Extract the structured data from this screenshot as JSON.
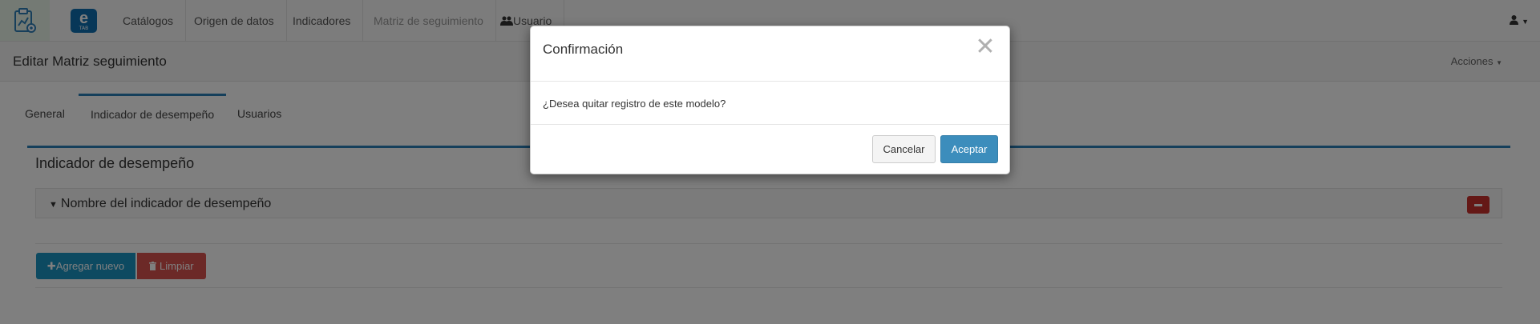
{
  "navbar": {
    "logo_icon": "clipboard-chart-icon",
    "brand_letter": "e",
    "brand_sub": "TAB",
    "items": [
      {
        "label": "Catálogos"
      },
      {
        "label": "Origen de datos"
      },
      {
        "label": "Indicadores"
      },
      {
        "label": "Matriz de seguimiento"
      },
      {
        "label": "Usuario"
      }
    ],
    "user_icon": "user-icon"
  },
  "page": {
    "title": "Editar Matriz seguimiento",
    "actions_label": "Acciones"
  },
  "tabs": [
    {
      "label": "General"
    },
    {
      "label": "Indicador de desempeño"
    },
    {
      "label": "Usuarios"
    }
  ],
  "panel": {
    "title": "Indicador de desempeño",
    "accordion_label": "Nombre del indicador de desempeño",
    "add_button": "Agregar nuevo",
    "clear_button": "Limpiar"
  },
  "modal": {
    "title": "Confirmación",
    "close_glyph": "✕",
    "message": "¿Desea quitar registro de este modelo?",
    "cancel_label": "Cancelar",
    "accept_label": "Aceptar"
  },
  "colors": {
    "primary": "#3c8dbc",
    "tab_accent": "#2a7fb6",
    "add_button": "#1b95c3",
    "danger": "#d9534f"
  }
}
